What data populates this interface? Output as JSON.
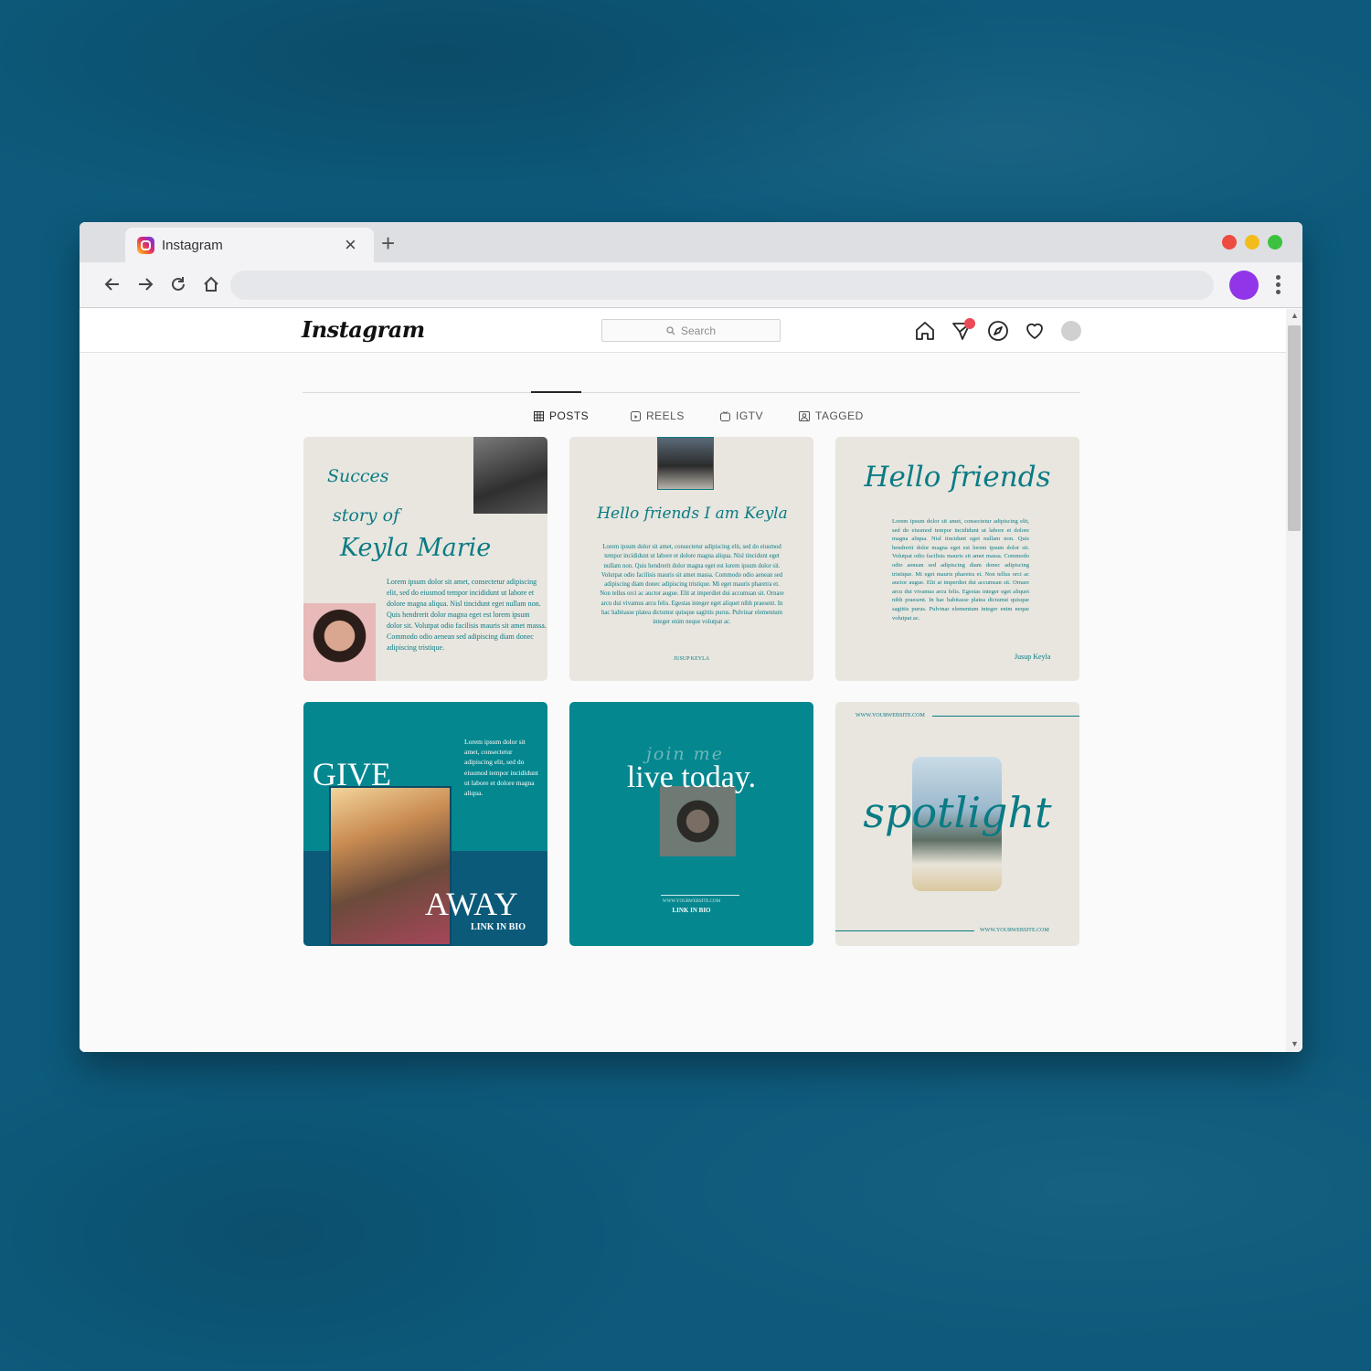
{
  "browser": {
    "tab_title": "Instagram",
    "tab_close": "×",
    "tab_new": "+",
    "window_dots": [
      "#ee4b40",
      "#f2bd1b",
      "#3cc23f"
    ]
  },
  "instagram": {
    "logo": "Instagram",
    "search_placeholder": "Search",
    "nav_icons": [
      "home-icon",
      "direct-message-icon",
      "explore-compass-icon",
      "heart-icon",
      "avatar"
    ]
  },
  "profile_tabs": [
    {
      "label": "POSTS",
      "icon": "grid-icon",
      "active": true
    },
    {
      "label": "REELS",
      "icon": "reels-icon",
      "active": false
    },
    {
      "label": "IGTV",
      "icon": "igtv-icon",
      "active": false
    },
    {
      "label": "TAGGED",
      "icon": "tagged-icon",
      "active": false
    }
  ],
  "posts": {
    "p1": {
      "script_line1": "Succes",
      "script_line2": "story of",
      "script_line3": "Keyla Marie",
      "body": "Lorem ipsum dolor sit amet, consectetur adipiscing elit, sed do eiusmod tempor incididunt ut labore et dolore magna aliqua. Nisl tincidunt eget nullam non. Quis hendrerit dolor magna eget est lorem ipsum dolor sit. Volutpat odio facilisis mauris sit amet massa. Commodo odio aenean sed adipiscing diam donec adipiscing tristique."
    },
    "p2": {
      "script": "Hello friends I am Keyla",
      "body": "Lorem ipsum dolor sit amet, consectetur adipiscing elit, sed do eiusmod tempor incididunt ut labore et dolore magna aliqua. Nisl tincidunt eget nullam non. Quis hendrerit dolor magna eget est lorem ipsum dolor sit. Volutpat odio facilisis mauris sit amet massa. Commodo odio aenean sed adipiscing diam donec adipiscing tristique. Mi eget mauris pharetra et. Non tellus orci ac auctor augue. Elit at imperdiet dui accumsan sit. Ornare arcu dui vivamus arcu felis. Egestas integer eget aliquet nibh praesent. In hac habitasse platea dictumst quisque sagittis purus. Pulvinar elementum integer enim neque volutpat ac.",
      "signature": "JUSUP KEYLA"
    },
    "p3": {
      "script": "Hello friends",
      "body": "Lorem ipsum dolor sit amet, consectetur adipiscing elit, sed do eiusmod tempor incididunt ut labore et dolore magna aliqua. Nisl tincidunt eget nullam non. Quis hendrerit dolor magna eget est lorem ipsum dolor sit. Volutpat odio facilisis mauris sit amet massa. Commodo odio aenean sed adipiscing diam donec adipiscing tristique. Mi eget mauris pharetra et. Non tellus orci ac auctor augue. Elit at imperdiet dui accumsan sit. Ornare arcu dui vivamus arcu felis. Egestas integer eget aliquet nibh praesent. In hac habitasse platea dictumst quisque sagittis purus. Pulvinar elementum integer enim neque volutpat ac.",
      "signature": "Jusup Keyla"
    },
    "p4": {
      "text": "Lorem ipsum dolor sit amet, consectetur adipiscing elit, sed do eiusmod tempor incididunt ut labore et dolore magna aliqua.",
      "give": "GIVE",
      "away": "AWAY",
      "link": "LINK IN BIO"
    },
    "p5": {
      "script": "join me",
      "headline": "live today.",
      "website": "WWW.YOURWEBSITE.COM",
      "link": "LINK IN BIO"
    },
    "p6": {
      "website_top": "WWW.YOURWEBSITE.COM",
      "script": "spotlight",
      "website_bottom": "WWW.YOURWEBSITE.COM"
    }
  }
}
